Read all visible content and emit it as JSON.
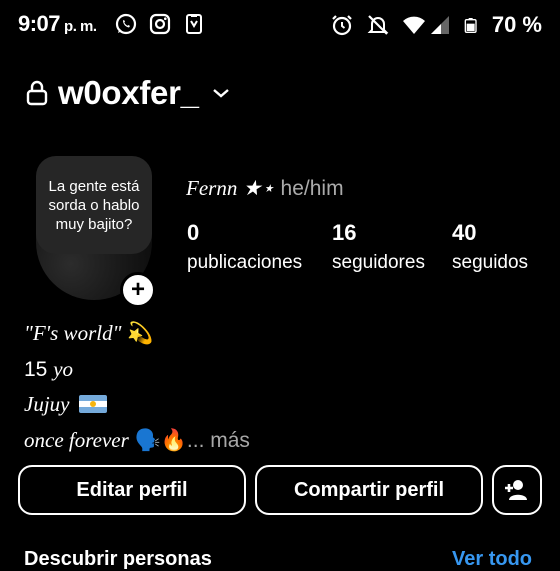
{
  "status_bar": {
    "time": "9:07",
    "ampm": "p. m.",
    "battery": "70 %",
    "left_icons": [
      "whatsapp-icon",
      "instagram-icon",
      "app-notification-icon"
    ],
    "right_icons": [
      "alarm-icon",
      "mute-icon",
      "wifi-icon",
      "signal-icon",
      "battery-icon"
    ]
  },
  "header": {
    "username": "w0oxfer_"
  },
  "profile": {
    "avatar_note": "La gente está sorda o hablo muy bajito?",
    "display_name": "Fernn ★⋆",
    "pronouns": "he/him"
  },
  "stats": [
    {
      "value": "0",
      "label": "publicaciones"
    },
    {
      "value": "16",
      "label": "seguidores"
    },
    {
      "value": "40",
      "label": "seguidos"
    }
  ],
  "bio": {
    "line1": "\"F's world\"",
    "line1_emoji": "💫",
    "line2_num": "15",
    "line2_text": "yo",
    "line3": "Jujuy",
    "line4": "once forever",
    "line4_emoji": "🗣️🔥",
    "more": "... más"
  },
  "buttons": {
    "edit": "Editar perfil",
    "share": "Compartir perfil"
  },
  "discover": {
    "title": "Descubrir personas",
    "see_all": "Ver todo"
  },
  "colors": {
    "background": "#000000",
    "link": "#3797f0",
    "muted": "#a8a8a8"
  }
}
